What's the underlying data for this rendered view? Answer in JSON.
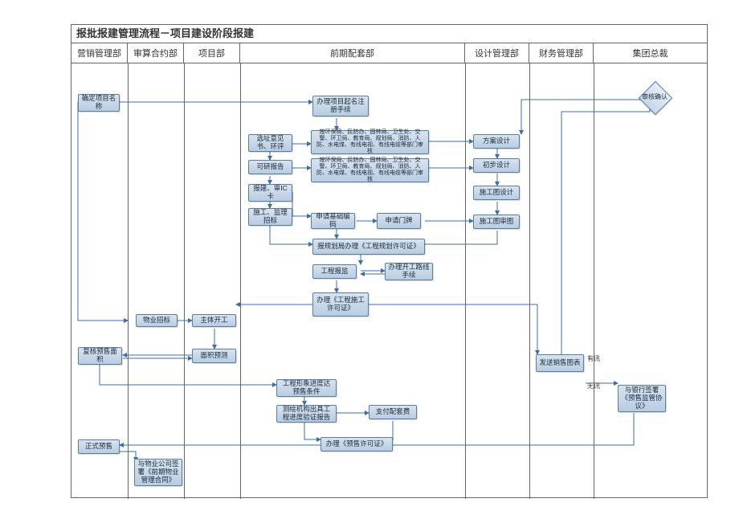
{
  "title": "报批报建管理流程－项目建设阶段报建",
  "lanes": [
    "营销管理部",
    "审算合约部",
    "项目部",
    "前期配套部",
    "设计管理部",
    "财务管理部",
    "集团总裁"
  ],
  "nodes": {
    "n_start_name": "确定项目名称",
    "n_rename": "办理项目起名注册手续",
    "n_dept1": "按环保局、民防办、园林局、卫生处、交警、环卫局、教育局、规划局、消防、人防、水电煤、有线电视、有线电缆等部门审核",
    "n_dept2": "按环保局、民防办、园林局、卫生处、交警、环卫局、教育局、规划局、消防、人防、水电煤、有线电视、有线电缆等部门审核",
    "n_scheme": "方案设计",
    "n_init": "初步设计",
    "n_const_draw": "施工图设计",
    "n_const_check": "施工图审图",
    "n_select": "选址意见书、环评",
    "n_feasibility": "可研报告",
    "n_baojian": "报建、审IC卡",
    "n_bid_const": "施工、监理招标",
    "n_basecode": "申请基础编码",
    "n_gate": "申请门牌",
    "n_plan_permit": "报规划局办理《工程规划许可证》",
    "n_baojianshu": "工程报监",
    "n_kaigong": "办理开工路线手续",
    "n_const_permit": "办理《工程施工许可证》",
    "n_prop_bid": "物业招标",
    "n_main_start": "主体开工",
    "n_area_check": "复核预售面积",
    "n_area_pre": "面积预测",
    "n_img_cond": "工程形象进度达预售条件",
    "n_surv_report": "测绘机构出具工程进度验证报告",
    "n_pay": "支付配套费",
    "n_presale_permit": "办理《预售许可证》",
    "n_official_sale": "正式预售",
    "n_prop_contract": "与物业公司签署《前期物业管理合同》",
    "n_send_sales": "发送销售图表",
    "n_bank": "与银行签署《预售监管协议》",
    "d_approve": "审核确认"
  },
  "edge_labels": {
    "e_yes": "有讯",
    "e_no": "无讯"
  }
}
